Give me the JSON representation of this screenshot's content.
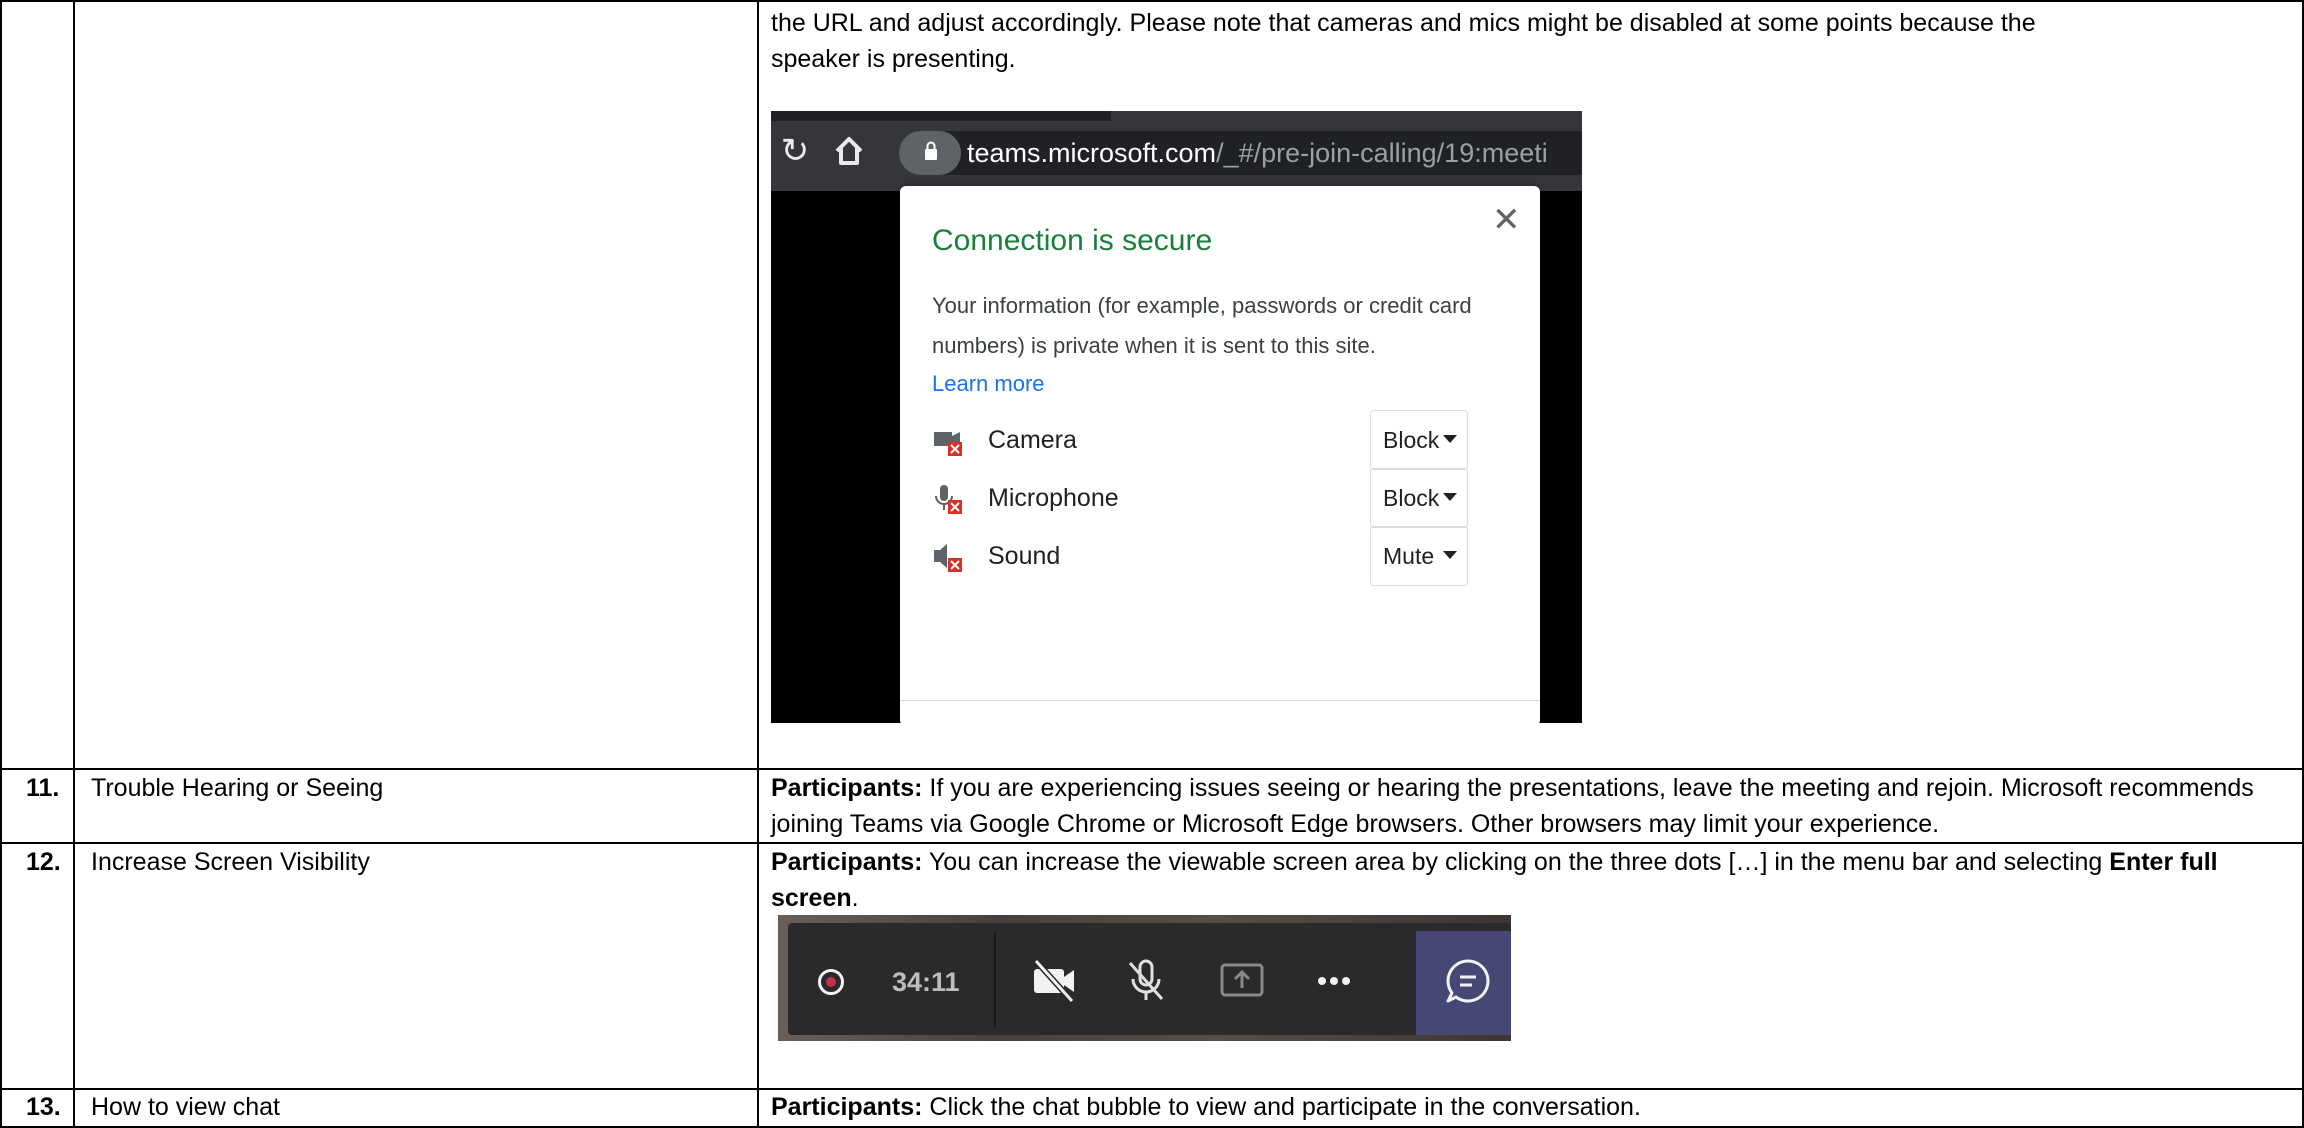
{
  "row10": {
    "instructions_line1": "the URL and adjust accordingly.  Please note that cameras and mics might be disabled at some points because the",
    "instructions_line2": "speaker is presenting."
  },
  "chrome_popup": {
    "url_domain": "teams.microsoft.com",
    "url_path": "/_#/pre-join-calling/19:meeti",
    "title": "Connection is secure",
    "description": "Your information (for example, passwords or credit card numbers) is private when it is sent to this site.",
    "learn_more": "Learn more",
    "permissions": [
      {
        "label": "Camera",
        "value": "Block",
        "icon": "camera-blocked-icon"
      },
      {
        "label": "Microphone",
        "value": "Block",
        "icon": "microphone-blocked-icon"
      },
      {
        "label": "Sound",
        "value": "Mute",
        "icon": "sound-muted-icon"
      }
    ],
    "colors": {
      "secure_green": "#188038",
      "link_blue": "#1a73e8",
      "toolbar": "#35363a"
    }
  },
  "rows": [
    {
      "number": "11.",
      "topic": "Trouble Hearing or Seeing",
      "label": "Participants:",
      "text": " If you are experiencing issues seeing or hearing the presentations, leave the meeting and rejoin. Microsoft recommends joining Teams via Google Chrome or Microsoft Edge browsers. Other browsers may limit your experience."
    },
    {
      "number": "12.",
      "topic": "Increase Screen Visibility",
      "label": "Participants:",
      "text": " You can increase the viewable screen area by clicking on the three dots […] in the menu bar and selecting ",
      "bold_end": "Enter full screen",
      "end": "."
    },
    {
      "number": "13.",
      "topic": "How to view chat",
      "label": "Participants:",
      "text": " Click the chat bubble to view and participate in the conversation."
    }
  ],
  "teams_toolbar": {
    "timer": "34:11",
    "icons": [
      "record-icon",
      "camera-off-icon",
      "mic-off-icon",
      "share-screen-icon",
      "more-options-icon",
      "chat-bubble-icon"
    ]
  }
}
